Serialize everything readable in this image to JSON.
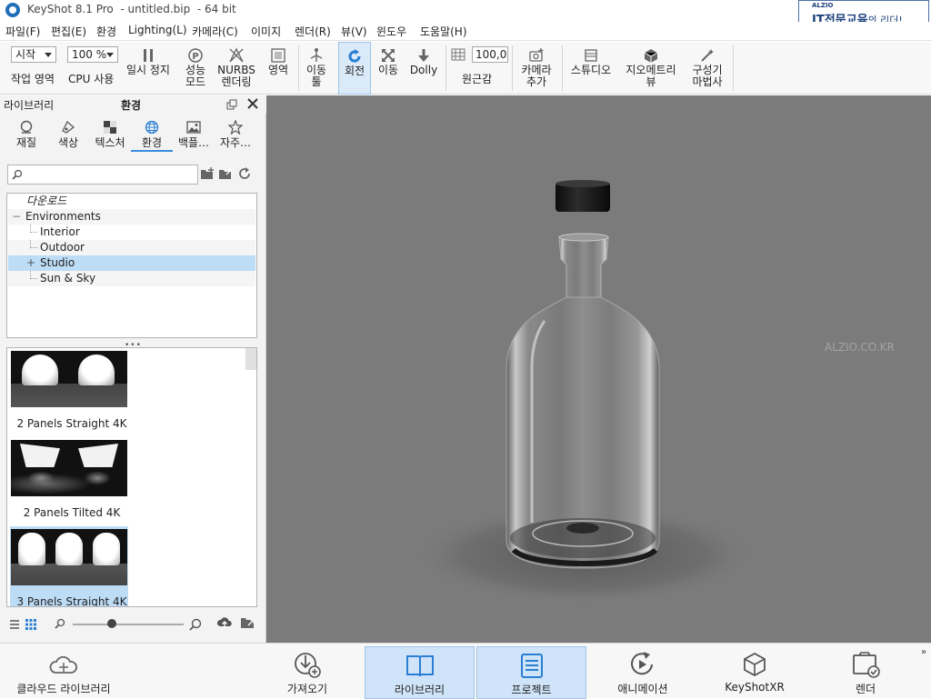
{
  "window": {
    "title": "KeyShot 8.1 Pro  - untitled.bip  - 64 bit"
  },
  "brand": {
    "small": "ALZIO",
    "main": "IT전문교육",
    "suffix": "의 리더!"
  },
  "menu": [
    "파일(F)",
    "편집(E)",
    "환경",
    "Lighting(L)",
    "카메라(C)",
    "이미지",
    "렌더(R)",
    "뷰(V)",
    "윈도우",
    "도움말(H)"
  ],
  "toolbar": {
    "workspace_select": "시작",
    "workspace_label": "작업 영역",
    "cpu_select": "100 %",
    "cpu_label": "CPU 사용",
    "pause_label": "일시 정지",
    "perf_label": "성능\n모드",
    "nurbs_label": "NURBS\n렌더링",
    "region_label": "영역",
    "move_tool_label": "이동\n툴",
    "rotate_label": "회전",
    "pan_label": "이동",
    "dolly_label": "Dolly",
    "perspective_value": "100,0",
    "perspective_label": "원근감",
    "add_camera_label": "카메라\n추가",
    "studio_label": "스튜디오",
    "geometry_view_label": "지오메트리\n뷰",
    "wizard_label": "구성기\n마법사"
  },
  "left_panel": {
    "library_title": "라이브러리",
    "section_title": "환경",
    "tabs": [
      "재질",
      "색상",
      "텍스처",
      "환경",
      "백플…",
      "자주…"
    ],
    "active_tab": "환경",
    "search_placeholder": "",
    "tree": [
      {
        "label": "다운로드",
        "italic": true,
        "level": 0
      },
      {
        "label": "Environments",
        "level": 0,
        "expander": "−"
      },
      {
        "label": "Interior",
        "level": 1
      },
      {
        "label": "Outdoor",
        "level": 1
      },
      {
        "label": "Studio",
        "level": 1,
        "expander": "+",
        "selected": true
      },
      {
        "label": "Sun & Sky",
        "level": 1
      }
    ],
    "thumbnails": [
      {
        "label": "2 Panels Straight 4K"
      },
      {
        "label": "2 Panels Tilted 4K"
      },
      {
        "label": "3 Panels Straight 4K",
        "selected": true
      }
    ],
    "zoom_level": 0.35
  },
  "viewport": {
    "watermark": "ALZIO.CO.KR",
    "background": "#7b7b7b"
  },
  "bottom_bar": {
    "cloud_label": "클라우드 라이브러리",
    "import_label": "가져오기",
    "library_label": "라이브러리",
    "project_label": "프로젝트",
    "animation_label": "애니메이션",
    "keyshotxr_label": "KeyShotXR",
    "render_label": "렌더"
  },
  "colors": {
    "accent": "#3a8dde",
    "active_bg": "#dbeaf8",
    "selected_bg": "#bddcf6"
  }
}
